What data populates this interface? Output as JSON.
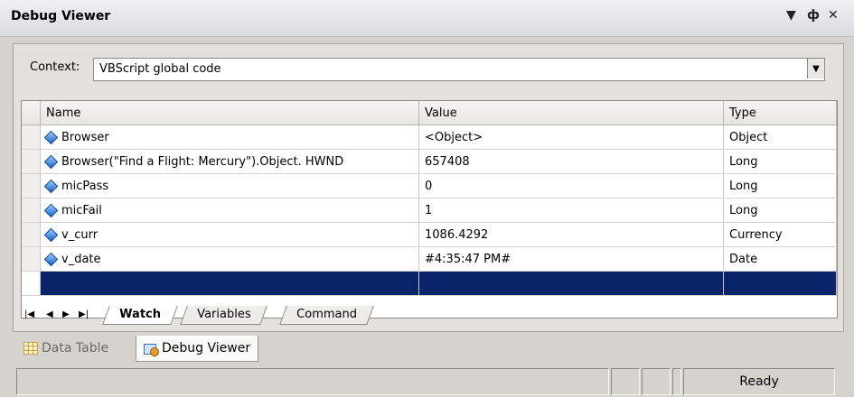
{
  "window": {
    "title": "Debug Viewer",
    "dropdown_icon": "▼",
    "pin_icon": "ф",
    "close_icon": "✕"
  },
  "context": {
    "label": "Context:",
    "value": "VBScript global code"
  },
  "grid": {
    "headers": [
      "Name",
      "Value",
      "Type"
    ],
    "rows": [
      {
        "name": "Browser",
        "value": "<Object>",
        "type": "Object"
      },
      {
        "name": "Browser(\"Find a Flight: Mercury\").Object. HWND",
        "value": "657408",
        "type": "Long"
      },
      {
        "name": "micPass",
        "value": "0",
        "type": "Long"
      },
      {
        "name": "micFail",
        "value": "1",
        "type": "Long"
      },
      {
        "name": "v_curr",
        "value": "1086.4292",
        "type": "Currency"
      },
      {
        "name": "v_date",
        "value": "#4:35:47 PM#",
        "type": "Date"
      }
    ]
  },
  "sheet_tabs": [
    "Watch",
    "Variables",
    "Command"
  ],
  "sheet_nav": [
    "|◀",
    "◀",
    "▶",
    "▶|"
  ],
  "pane_tabs": [
    "Data Table",
    "Debug Viewer"
  ],
  "status": {
    "ready": "Ready"
  },
  "colors": {
    "selection": "#0a246a",
    "panel": "#d6d3ce"
  }
}
